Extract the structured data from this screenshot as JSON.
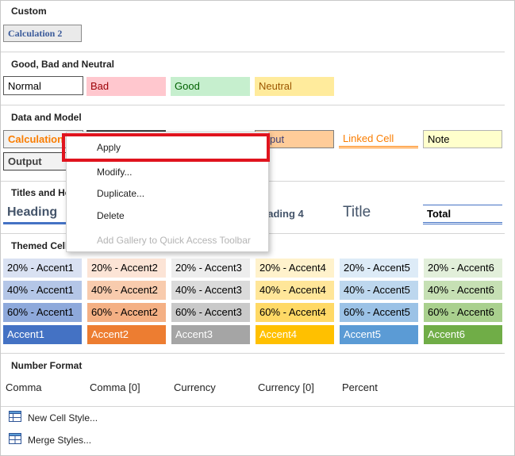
{
  "sections": {
    "custom": "Custom",
    "good_bad": "Good, Bad and Neutral",
    "data_model": "Data and Model",
    "titles": "Titles and He",
    "themed": "Themed Cell",
    "number": "Number Format"
  },
  "custom_cells": [
    "Calculation 2"
  ],
  "good_bad_cells": [
    "Normal",
    "Bad",
    "Good",
    "Neutral"
  ],
  "data_model_cells": [
    "Calculation",
    "Output",
    "put",
    "Linked Cell",
    "Note"
  ],
  "titles_cells": [
    "Heading",
    "eading 4",
    "Title",
    "Total"
  ],
  "themed_rows": [
    [
      "20% - Accent1",
      "20% - Accent2",
      "20% - Accent3",
      "20% - Accent4",
      "20% - Accent5",
      "20% - Accent6"
    ],
    [
      "40% - Accent1",
      "40% - Accent2",
      "40% - Accent3",
      "40% - Accent4",
      "40% - Accent5",
      "40% - Accent6"
    ],
    [
      "60% - Accent1",
      "60% - Accent2",
      "60% - Accent3",
      "60% - Accent4",
      "60% - Accent5",
      "60% - Accent6"
    ],
    [
      "Accent1",
      "Accent2",
      "Accent3",
      "Accent4",
      "Accent5",
      "Accent6"
    ]
  ],
  "number_cells": [
    "Comma",
    "Comma [0]",
    "Currency",
    "Currency [0]",
    "Percent"
  ],
  "context_menu": [
    {
      "label": "Apply",
      "disabled": false
    },
    {
      "label": "Modify...",
      "disabled": false
    },
    {
      "label": "Duplicate...",
      "disabled": false
    },
    {
      "label": "Delete",
      "disabled": false
    },
    {
      "label": "Add Gallery to Quick Access Toolbar",
      "disabled": true
    }
  ],
  "bottom": {
    "new_style": "New Cell Style...",
    "merge_styles": "Merge Styles..."
  },
  "colors": {
    "highlight_border": "#e0141e",
    "accent1": "#4472c4",
    "accent2": "#ed7d31",
    "accent3": "#a5a5a5",
    "accent4": "#ffc000",
    "accent5": "#5b9bd5",
    "accent6": "#70ad47"
  }
}
